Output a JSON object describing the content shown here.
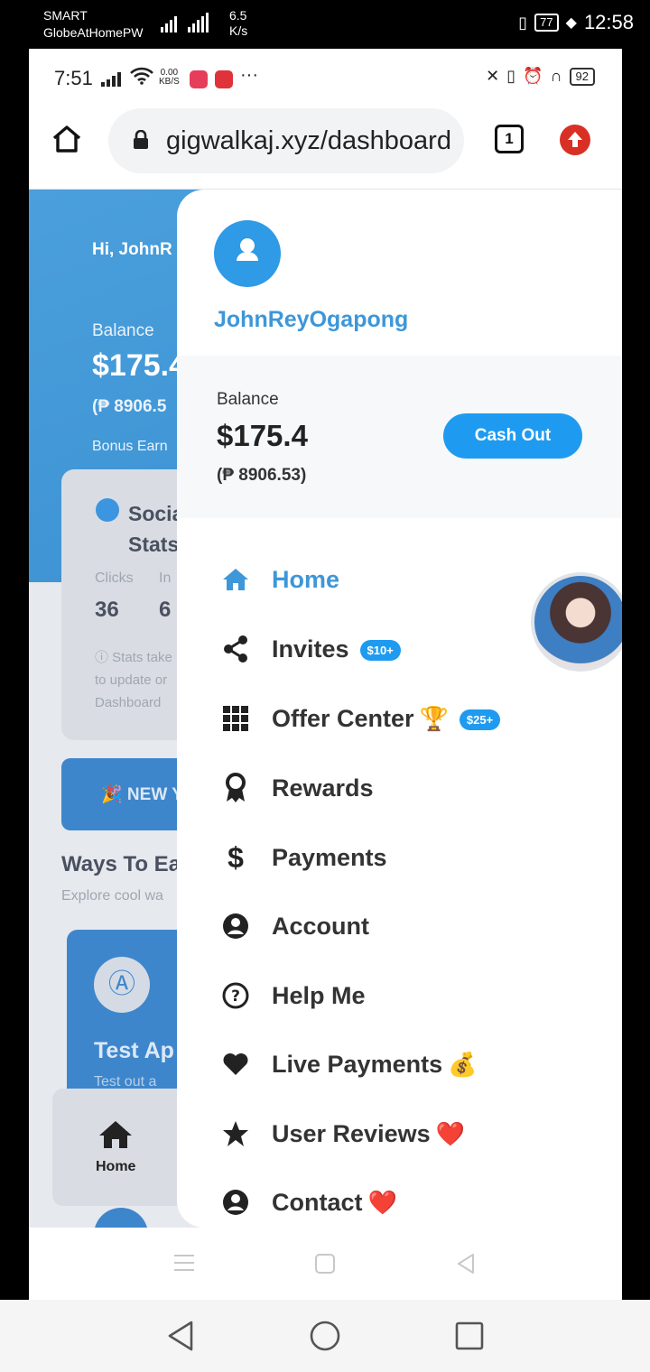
{
  "outer_status": {
    "carrier_1": "SMART",
    "carrier_2": "GlobeAtHomePW",
    "speed_value": "6.5",
    "speed_unit": "K/s",
    "battery": "77",
    "time": "12:58"
  },
  "inner_status": {
    "time": "7:51",
    "net_speed_value": "0.00",
    "net_speed_unit": "KB/S",
    "more": "···",
    "battery": "92"
  },
  "browser": {
    "url": "gigwalkaj.xyz/dashboard",
    "tab_count": "1"
  },
  "background": {
    "greeting": "Hi, JohnR",
    "balance_label": "Balance",
    "balance": "$175.4",
    "php": "(₱ 8906.5",
    "bonus": "Bonus Earn",
    "social_title_1": "Socia",
    "social_title_2": "Stats",
    "clicks_label": "Clicks",
    "invites_label": "In",
    "clicks_value": "36",
    "invites_value": "6",
    "note_1": "ⓘ Stats take",
    "note_2": "to update or",
    "note_3": "Dashboard",
    "new_banner": "🎉 NEW Y",
    "ways_title": "Ways To Ea",
    "ways_sub": "Explore cool wa",
    "test_title": "Test Ap",
    "test_sub": "Test out a",
    "nav_home": "Home"
  },
  "drawer": {
    "username": "JohnReyOgapong",
    "balance_label": "Balance",
    "balance_usd": "$175.4",
    "balance_php": "(₱ 8906.53)",
    "cashout_label": "Cash Out",
    "menu": [
      {
        "label": "Home",
        "icon": "home-icon",
        "active": true
      },
      {
        "label": "Invites",
        "icon": "share-icon",
        "badge": "$10+"
      },
      {
        "label": "Offer Center",
        "icon": "grid-icon",
        "emoji": "🏆",
        "badge": "$25+"
      },
      {
        "label": "Rewards",
        "icon": "award-icon"
      },
      {
        "label": "Payments",
        "icon": "dollar-icon"
      },
      {
        "label": "Account",
        "icon": "user-circle-icon"
      },
      {
        "label": "Help Me",
        "icon": "question-circle-icon"
      },
      {
        "label": "Live Payments",
        "icon": "heart-icon",
        "emoji": "💰"
      },
      {
        "label": "User Reviews",
        "icon": "star-icon",
        "emoji": "❤️"
      },
      {
        "label": "Contact",
        "icon": "user-circle-icon",
        "emoji": "❤️"
      }
    ]
  },
  "colors": {
    "accent": "#1e9bf0",
    "link": "#3d97d9",
    "hero": "#4a9fdc"
  }
}
